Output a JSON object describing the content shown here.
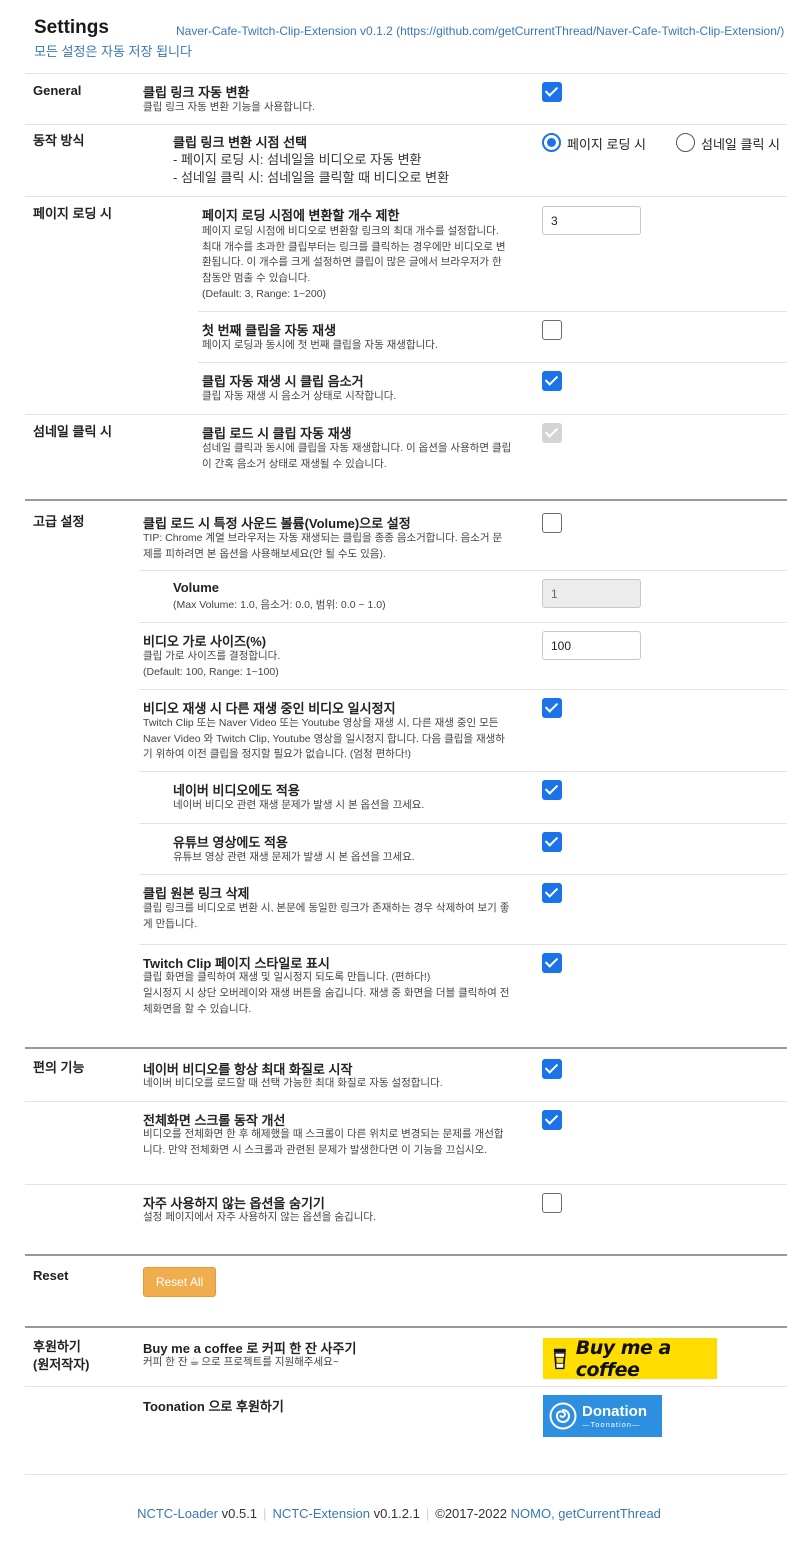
{
  "header": {
    "title": "Settings",
    "extension_link": "Naver-Cafe-Twitch-Clip-Extension v0.1.2 (https://github.com/getCurrentThread/Naver-Cafe-Twitch-Clip-Extension/)",
    "autosave_note": "모든 설정은 자동 저장 됩니다"
  },
  "sections": {
    "general": "General",
    "mode": "동작 방식",
    "page_loading": "페이지 로딩 시",
    "thumb_click": "섬네일 클릭 시",
    "advanced": "고급 설정",
    "convenience": "편의 기능",
    "reset": "Reset",
    "support_line1": "후원하기",
    "support_line2": "(원저작자)"
  },
  "options": {
    "link_convert": {
      "title": "클립 링크 자동 변환",
      "desc": "클립 링크 자동 변환 기능을 사용합니다.",
      "checked": true
    },
    "convert_timing": {
      "title": "클립 링크 변환 시점 선택",
      "desc1": "- 페이지 로딩 시: 섬네일을 비디오로 자동 변환",
      "desc2": "- 섬네일 클릭 시: 섬네일을 클릭할 때 비디오로 변환",
      "radio_page": "페이지 로딩 시",
      "radio_thumb": "섬네일 클릭 시",
      "selected": "page"
    },
    "limit": {
      "title": "페이지 로딩 시점에 변환할 개수 제한",
      "desc": "페이지 로딩 시점에 비디오로 변환할 링크의 최대 개수를 설정합니다. 최대 개수를 초과한 클립부터는 링크를 클릭하는 경우에만 비디오로 변환됩니다. 이 개수를 크게 설정하면 클립이 많은 글에서 브라우저가 한참동안 멈출 수 있습니다.",
      "default": "(Default: 3, Range: 1~200)",
      "value": "3"
    },
    "autoplay_first": {
      "title": "첫 번째 클립을 자동 재생",
      "desc": "페이지 로딩과 동시에 첫 번째 클립을 자동 재생합니다.",
      "checked": false
    },
    "autoplay_mute": {
      "title": "클립 자동 재생 시 클립 음소거",
      "desc": "클립 자동 재생 시 음소거 상태로 시작합니다.",
      "checked": true
    },
    "thumb_autoplay": {
      "title": "클립 로드 시 클립 자동 재생",
      "desc": "섬네일 클릭과 동시에 클립을 자동 재생합니다. 이 옵션을 사용하면 클립이 간혹 음소거 상태로 재생될 수 있습니다.",
      "checked": true,
      "disabled": true
    },
    "volume_set": {
      "title": "클립 로드 시 특정 사운드 볼륨(Volume)으로 설정",
      "desc": "TIP: Chrome 계열 브라우저는 자동 재생되는 클립을 종종 음소거합니다. 음소거 문제를 피하려면 본 옵션을 사용해보세요(안 될 수도 있음).",
      "checked": false
    },
    "volume": {
      "title": "Volume",
      "desc": "(Max Volume: 1.0, 음소거: 0.0, 범위: 0.0 ~ 1.0)",
      "value": "1"
    },
    "video_width": {
      "title": "비디오 가로 사이즈(%)",
      "desc": "클립 가로 사이즈를 결정합니다.",
      "default": "(Default: 100, Range: 1~100)",
      "value": "100"
    },
    "pause_others": {
      "title": "비디오 재생 시 다른 재생 중인 비디오 일시정지",
      "desc": "Twitch Clip 또는 Naver Video 또는 Youtube 영상을 재생 시, 다른 재생 중인 모든 Naver Video 와 Twitch Clip, Youtube 영상을 일시정지 합니다. 다음 클립을 재생하기 위하여 이전 클립을 정지할 필요가 없습니다. (엄청 편하다!)",
      "checked": true
    },
    "apply_naver": {
      "title": "네이버 비디오에도 적용",
      "desc": "네이버 비디오 관련 재생 문제가 발생 시 본 옵션을 끄세요.",
      "checked": true
    },
    "apply_youtube": {
      "title": "유튜브 영상에도 적용",
      "desc": "유튜브 영상 관련 재생 문제가 발생 시 본 옵션을 끄세요.",
      "checked": true
    },
    "remove_link": {
      "title": "클립 원본 링크 삭제",
      "desc": "클립 링크를 비디오로 변환 시, 본문에 동일한 링크가 존재하는 경우 삭제하여 보기 좋게 만듭니다.",
      "checked": true
    },
    "twitch_style": {
      "title": "Twitch Clip 페이지 스타일로 표시",
      "desc1": "클립 화면을 클릭하여 재생 및 일시정지 되도록 만듭니다. (편하다!)",
      "desc2": "일시정지 시 상단 오버레이와 재생 버튼을 숨깁니다. 재생 중 화면을 더블 클릭하여 전체화면을 할 수 있습니다.",
      "checked": true
    },
    "naver_max_quality": {
      "title": "네이버 비디오를 항상 최대 화질로 시작",
      "desc": "네이버 비디오를 로드할 때 선택 가능한 최대 화질로 자동 설정합니다.",
      "checked": true
    },
    "fullscreen_scroll": {
      "title": "전체화면 스크롤 동작 개선",
      "desc": "비디오를 전체화면 한 후 해제했을 때 스크롤이 다른 위치로 변경되는 문제를 개선합니다. 만약 전체화면 시 스크롤과 관련된 문제가 발생한다면 이 기능을 끄십시오.",
      "checked": true
    },
    "hide_rare": {
      "title": "자주 사용하지 않는 옵션을 숨기기",
      "desc": "설정 페이지에서 자주 사용하지 않는 옵션을 숨깁니다.",
      "checked": false
    }
  },
  "reset": {
    "button": "Reset All"
  },
  "support": {
    "bmc_title": "Buy me a coffee 로 커피 한 잔 사주기",
    "bmc_desc_before": "커피 한 잔",
    "bmc_desc_after": "으로 프로젝트를 지원해주세요~",
    "bmc_badge": "Buy me a coffee",
    "toon_title": "Toonation 으로 후원하기",
    "toon_badge": "Donation",
    "toon_badge_sub": "Toonation"
  },
  "footer": {
    "loader_name": "NCTC-Loader",
    "loader_ver": "v0.5.1",
    "ext_name": "NCTC-Extension",
    "ext_ver": "v0.1.2.1",
    "copyright": "©2017-2022",
    "authors": "NOMO, getCurrentThread"
  },
  "colors": {
    "link": "#3a78b4",
    "checkbox": "#1a73e8",
    "reset_button": "#efad4e",
    "bmc_yellow": "#ffdd00",
    "toonation_blue": "#2d8fe0"
  }
}
